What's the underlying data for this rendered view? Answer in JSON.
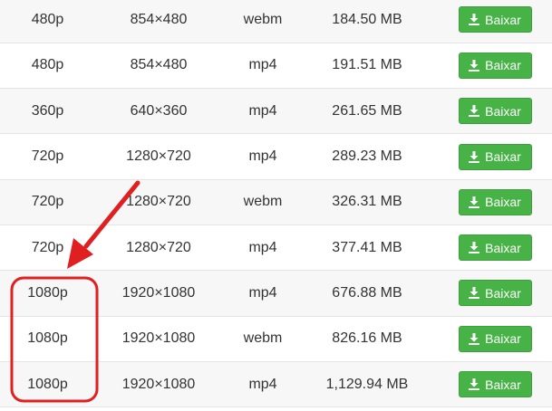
{
  "downloads": {
    "button_label": "Baixar",
    "button_icon": "download-icon",
    "button_color": "#47b347",
    "rows": [
      {
        "quality": "480p",
        "resolution": "854×480",
        "format": "webm",
        "size": "184.50 MB"
      },
      {
        "quality": "480p",
        "resolution": "854×480",
        "format": "mp4",
        "size": "191.51 MB"
      },
      {
        "quality": "360p",
        "resolution": "640×360",
        "format": "mp4",
        "size": "261.65 MB"
      },
      {
        "quality": "720p",
        "resolution": "1280×720",
        "format": "mp4",
        "size": "289.23 MB"
      },
      {
        "quality": "720p",
        "resolution": "1280×720",
        "format": "webm",
        "size": "326.31 MB"
      },
      {
        "quality": "720p",
        "resolution": "1280×720",
        "format": "mp4",
        "size": "377.41 MB"
      },
      {
        "quality": "1080p",
        "resolution": "1920×1080",
        "format": "mp4",
        "size": "676.88 MB"
      },
      {
        "quality": "1080p",
        "resolution": "1920×1080",
        "format": "webm",
        "size": "826.16 MB"
      },
      {
        "quality": "1080p",
        "resolution": "1920×1080",
        "format": "mp4",
        "size": "1,129.94 MB"
      }
    ]
  },
  "annotation": {
    "color": "#e02020",
    "highlight": "1080p rows"
  }
}
